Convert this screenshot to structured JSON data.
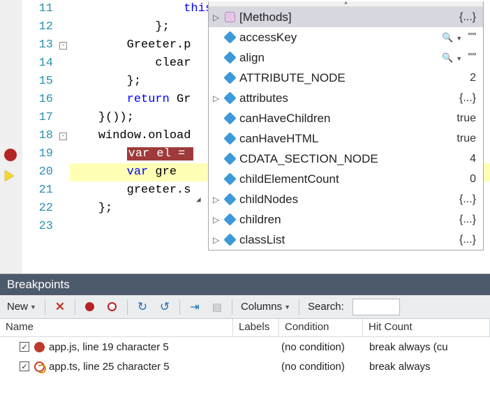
{
  "editor": {
    "lines": [
      {
        "num": 11,
        "indent": "                ",
        "tokens": [
          {
            "t": "this",
            "c": "kw"
          },
          {
            "t": ".",
            "c": "plain"
          }
        ]
      },
      {
        "num": 12,
        "indent": "            ",
        "tokens": [
          {
            "t": "};",
            "c": "plain"
          }
        ]
      },
      {
        "num": 13,
        "indent": "        ",
        "fold": true,
        "tokens": [
          {
            "t": "Greeter.p",
            "c": "plain"
          }
        ]
      },
      {
        "num": 14,
        "indent": "            ",
        "tokens": [
          {
            "t": "clear",
            "c": "plain"
          }
        ]
      },
      {
        "num": 15,
        "indent": "        ",
        "tokens": [
          {
            "t": "};",
            "c": "plain"
          }
        ]
      },
      {
        "num": 16,
        "indent": "        ",
        "tokens": [
          {
            "t": "return",
            "c": "kw"
          },
          {
            "t": " Gr",
            "c": "plain"
          }
        ]
      },
      {
        "num": 17,
        "indent": "    ",
        "tokens": [
          {
            "t": "}());",
            "c": "plain"
          }
        ]
      },
      {
        "num": 18,
        "indent": "    ",
        "fold": true,
        "tokens": [
          {
            "t": "window.onload",
            "c": "plain"
          }
        ]
      },
      {
        "num": 19,
        "indent": "        ",
        "tokens": [
          {
            "t": "var el = ",
            "c": "hl-red"
          }
        ],
        "breakpoint": true
      },
      {
        "num": 20,
        "indent": "        ",
        "tokens": [
          {
            "t": "var",
            "c": "kw"
          },
          {
            "t": " gre",
            "c": "plain"
          }
        ],
        "exec": true,
        "execbg": true
      },
      {
        "num": 21,
        "indent": "        ",
        "tokens": [
          {
            "t": "greeter.s",
            "c": "plain"
          }
        ]
      },
      {
        "num": 22,
        "indent": "    ",
        "tokens": [
          {
            "t": "};",
            "c": "plain"
          }
        ]
      },
      {
        "num": 23,
        "indent": "",
        "tokens": []
      }
    ]
  },
  "autocomplete": {
    "items": [
      {
        "exp": "▷",
        "icon": "hex",
        "label": "[Methods]",
        "val": "{...}",
        "sel": true
      },
      {
        "exp": "",
        "icon": "cube",
        "label": "accessKey",
        "val": "⌕ ▾  \"\""
      },
      {
        "exp": "",
        "icon": "cube",
        "label": "align",
        "val": "⌕ ▾  \"\""
      },
      {
        "exp": "",
        "icon": "cube",
        "label": "ATTRIBUTE_NODE",
        "val": "2"
      },
      {
        "exp": "▷",
        "icon": "cube",
        "label": "attributes",
        "val": "{...}"
      },
      {
        "exp": "",
        "icon": "cube",
        "label": "canHaveChildren",
        "val": "true"
      },
      {
        "exp": "",
        "icon": "cube",
        "label": "canHaveHTML",
        "val": "true"
      },
      {
        "exp": "",
        "icon": "cube",
        "label": "CDATA_SECTION_NODE",
        "val": "4"
      },
      {
        "exp": "",
        "icon": "cube",
        "label": "childElementCount",
        "val": "0"
      },
      {
        "exp": "▷",
        "icon": "cube",
        "label": "childNodes",
        "val": "{...}"
      },
      {
        "exp": "▷",
        "icon": "cube",
        "label": "children",
        "val": "{...}"
      },
      {
        "exp": "▷",
        "icon": "cube",
        "label": "classList",
        "val": "{...}"
      }
    ],
    "scroll_arrow": "◢"
  },
  "panel": {
    "title": "Breakpoints",
    "toolbar": {
      "new": "New",
      "columns": "Columns",
      "search": "Search:"
    },
    "headers": {
      "name": "Name",
      "labels": "Labels",
      "condition": "Condition",
      "hit": "Hit Count"
    },
    "rows": [
      {
        "checked": true,
        "icon": "red",
        "name": "app.js, line 19 character 5",
        "labels": "",
        "cond": "(no condition)",
        "hit": "break always (cu"
      },
      {
        "checked": true,
        "icon": "map",
        "name": "app.ts, line 25 character 5",
        "labels": "",
        "cond": "(no condition)",
        "hit": "break always"
      }
    ]
  }
}
